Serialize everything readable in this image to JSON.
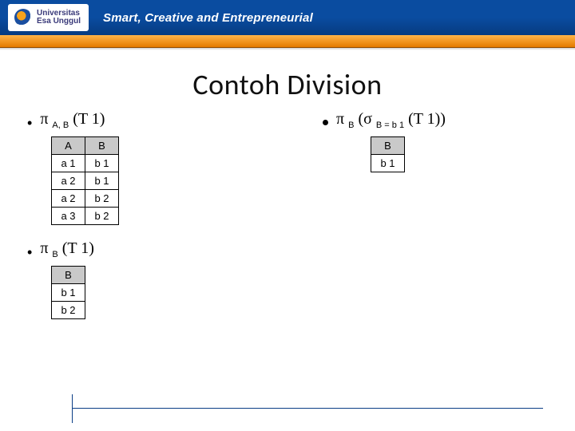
{
  "header": {
    "uni_top": "Universitas",
    "uni_bottom": "Esa Unggul",
    "tagline": "Smart, Creative and Entrepreneurial"
  },
  "title": "Contoh Division",
  "exprs": {
    "pi": "π",
    "sigma": "σ",
    "left1_sub": "A, B",
    "left1_arg": "(T 1)",
    "left2_sub": "B",
    "left2_arg": "(T 1)",
    "right_sub_outer": "B",
    "right_open": "(",
    "right_sub_inner": "B = b 1",
    "right_arg": "(T 1))"
  },
  "tables": {
    "t1": {
      "headers": [
        "A",
        "B"
      ],
      "rows": [
        [
          "a 1",
          "b 1"
        ],
        [
          "a 2",
          "b 1"
        ],
        [
          "a 2",
          "b 2"
        ],
        [
          "a 3",
          "b 2"
        ]
      ]
    },
    "t2": {
      "headers": [
        "B"
      ],
      "rows": [
        [
          "b 1"
        ],
        [
          "b 2"
        ]
      ]
    },
    "t3": {
      "headers": [
        "B"
      ],
      "rows": [
        [
          "b 1"
        ]
      ]
    }
  }
}
